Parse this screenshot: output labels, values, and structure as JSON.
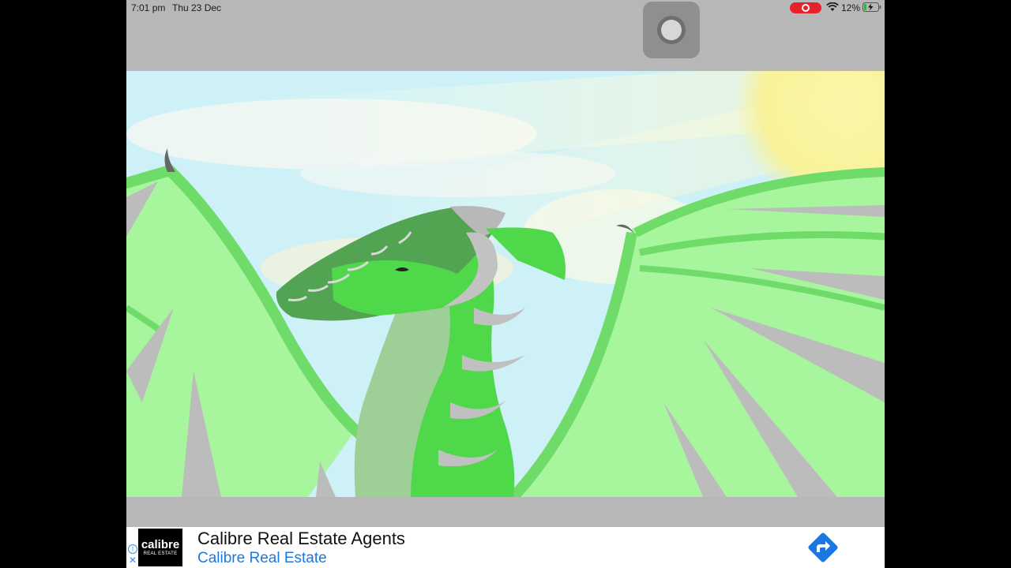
{
  "status_bar": {
    "time": "7:01 pm",
    "date": "Thu 23 Dec",
    "battery": "12%",
    "icons": [
      "record-icon",
      "wifi-icon",
      "battery-charging-icon"
    ]
  },
  "ad": {
    "logo_name": "calibre",
    "logo_tagline": "REAL ESTATE",
    "title": "Calibre Real Estate Agents",
    "subtitle": "Calibre Real Estate",
    "icons": [
      "info-icon",
      "close-icon",
      "directions-arrow-icon"
    ]
  },
  "colors": {
    "record": "#e8202a",
    "ad_link": "#1b78e0",
    "wing_green": "#6fdc6a",
    "dragon_green": "#4fd84a",
    "sky": "#cdf1f6",
    "sun": "#f9f3a0"
  }
}
